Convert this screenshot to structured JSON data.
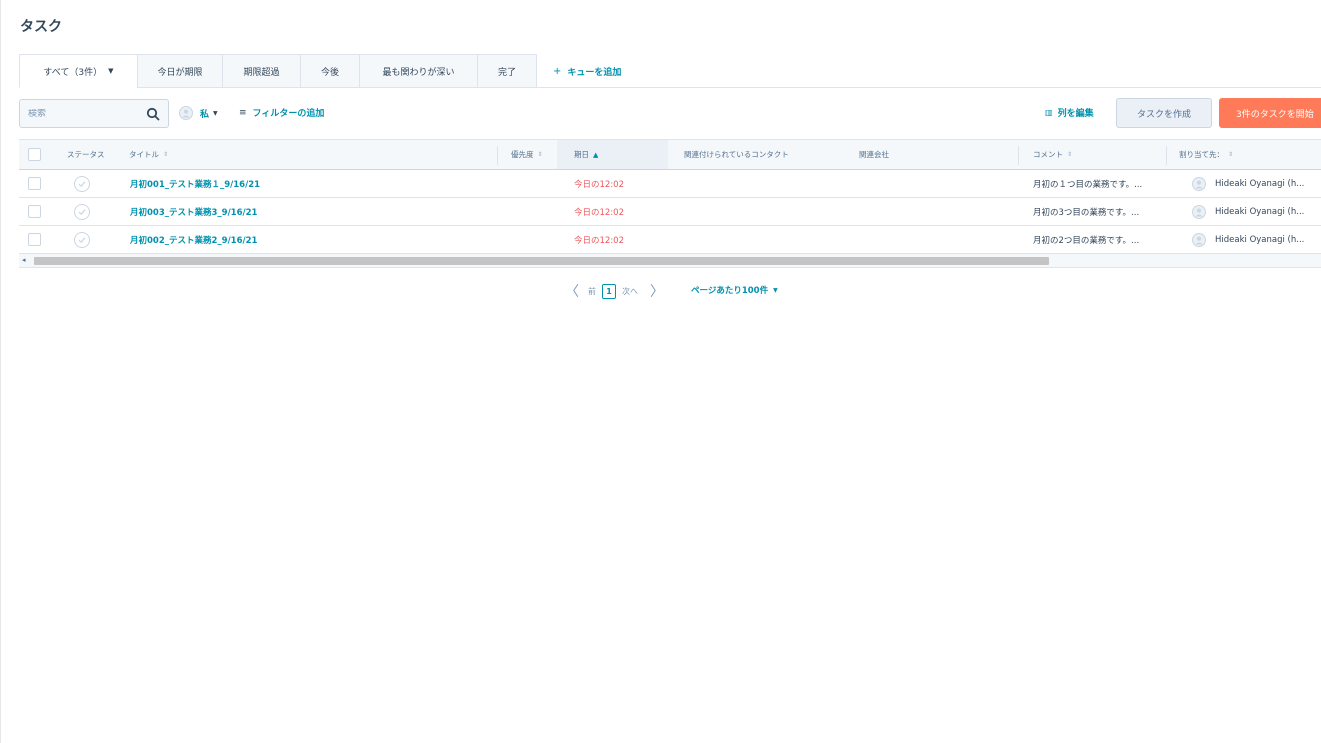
{
  "page": {
    "title": "タスク"
  },
  "tabs": [
    {
      "label": "すべて（3件）",
      "active": true
    },
    {
      "label": "今日が期限"
    },
    {
      "label": "期限超過"
    },
    {
      "label": "今後"
    },
    {
      "label": "最も関わりが深い"
    },
    {
      "label": "完了"
    }
  ],
  "add_queue_label": "キューを追加",
  "toolbar": {
    "search_placeholder": "検索",
    "owner_label": "私",
    "add_filter_label": "フィルターの追加",
    "edit_columns_label": "列を編集",
    "create_task_label": "タスクを作成",
    "start_tasks_label": "3件のタスクを開始"
  },
  "table": {
    "columns": {
      "status": "ステータス",
      "title": "タイトル",
      "priority": "優先度",
      "due": "期日",
      "contacts": "関連付けられているコンタクト",
      "company": "関連会社",
      "comment": "コメント",
      "assignee": "割り当て先："
    },
    "rows": [
      {
        "title": "月初001_テスト業務１_9/16/21",
        "due": "今日の12:02",
        "comment": "月初の１つ目の業務です。...",
        "assignee": "Hideaki Oyanagi (h..."
      },
      {
        "title": "月初003_テスト業務3_9/16/21",
        "due": "今日の12:02",
        "comment": "月初の3つ目の業務です。...",
        "assignee": "Hideaki Oyanagi (h..."
      },
      {
        "title": "月初002_テスト業務2_9/16/21",
        "due": "今日の12:02",
        "comment": "月初の2つ目の業務です。...",
        "assignee": "Hideaki Oyanagi (h..."
      }
    ]
  },
  "pagination": {
    "prev_label": "前",
    "current_page": "1",
    "next_label": "次へ",
    "per_page_label": "ページあたり100件"
  },
  "colors": {
    "accent": "#0091ae",
    "primary_button": "#ff7a59",
    "overdue": "#f2545b"
  }
}
